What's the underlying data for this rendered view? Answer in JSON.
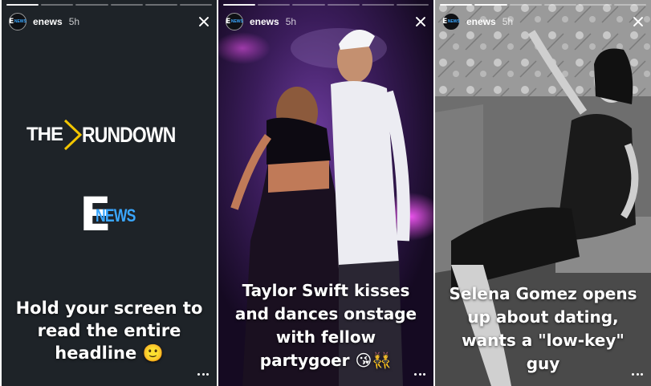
{
  "stories": [
    {
      "account": "enews",
      "age": "5h",
      "avatar_text": "E",
      "avatar_sub": "NEWS",
      "logo_the": "THE",
      "logo_rundown": "RUNDOWN",
      "logo_e": "E",
      "logo_news": "NEWS",
      "caption_lines": [
        "Hold your screen to",
        "read the entire",
        "headline 🙂"
      ]
    },
    {
      "account": "enews",
      "age": "5h",
      "avatar_text": "E",
      "avatar_sub": "NEWS",
      "caption_lines": [
        "Taylor Swift kisses",
        "and dances onstage",
        "with fellow",
        "partygoer 😘👯"
      ]
    },
    {
      "account": "enews",
      "age": "5h",
      "avatar_text": "E",
      "avatar_sub": "NEWS",
      "caption_lines": [
        "Selena Gomez opens",
        "up about dating,",
        "wants a \"low-key\"",
        "guy"
      ]
    }
  ],
  "colors": {
    "enews_blue": "#3aa7ff",
    "rundown_yellow": "#f2c500",
    "panel1_bg": "#1e2328"
  },
  "icons": {
    "close": "close-icon",
    "more": "more-options-icon"
  }
}
